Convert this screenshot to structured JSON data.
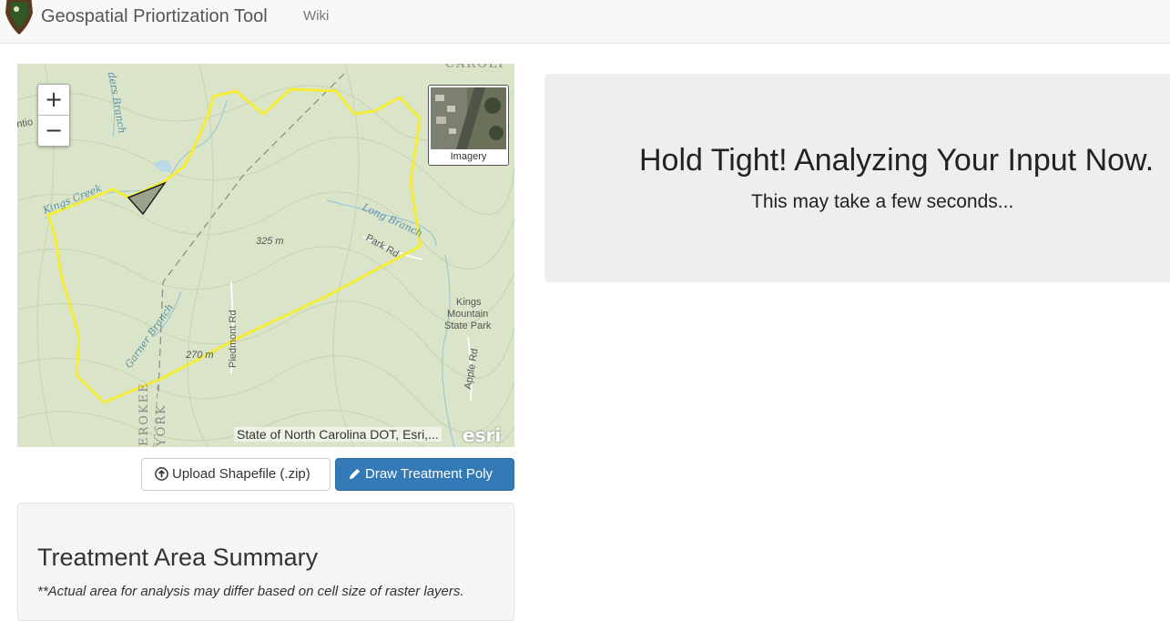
{
  "navbar": {
    "brand": "Geospatial Priortization Tool",
    "wiki_label": "Wiki"
  },
  "map": {
    "zoom_in_label": "+",
    "zoom_out_label": "−",
    "basemap_toggle_label": "Imagery",
    "attribution": "State of North Carolina DOT, Esri,...",
    "esri_logo": "esri",
    "labels": {
      "carolina": "CAROLI",
      "kings_creek": "Kings Creek",
      "long_branch": "Long Branch",
      "park_rd": "Park Rd",
      "elev_325": "325 m",
      "elev_270": "270 m",
      "piedmont_rd": "Piedmont Rd",
      "garner_branch": "Garner Branch",
      "kings_mountain_1": "Kings",
      "kings_mountain_2": "Mountain",
      "kings_mountain_3": "State Park",
      "apple_rd": "Apple Rd",
      "cherokee": "EROKEE",
      "york": "YORK",
      "branch": "ders Branch",
      "ntio": "ntio"
    },
    "colors": {
      "aoi_outline": "#f5ec3a",
      "treatment_fill": "#9aa38a",
      "terrain": "#d9e4c8"
    }
  },
  "actions": {
    "upload_label": "Upload Shapefile (.zip)",
    "draw_label": "Draw Treatment Poly",
    "upload_icon": "upload-circle-icon",
    "draw_icon": "pencil-icon"
  },
  "summary": {
    "title": "Treatment Area Summary",
    "note": "**Actual area for analysis may differ based on cell size of raster layers."
  },
  "loading": {
    "title": "Hold Tight! Analyzing Your Input Now.",
    "subtitle": "This may take a few seconds..."
  }
}
